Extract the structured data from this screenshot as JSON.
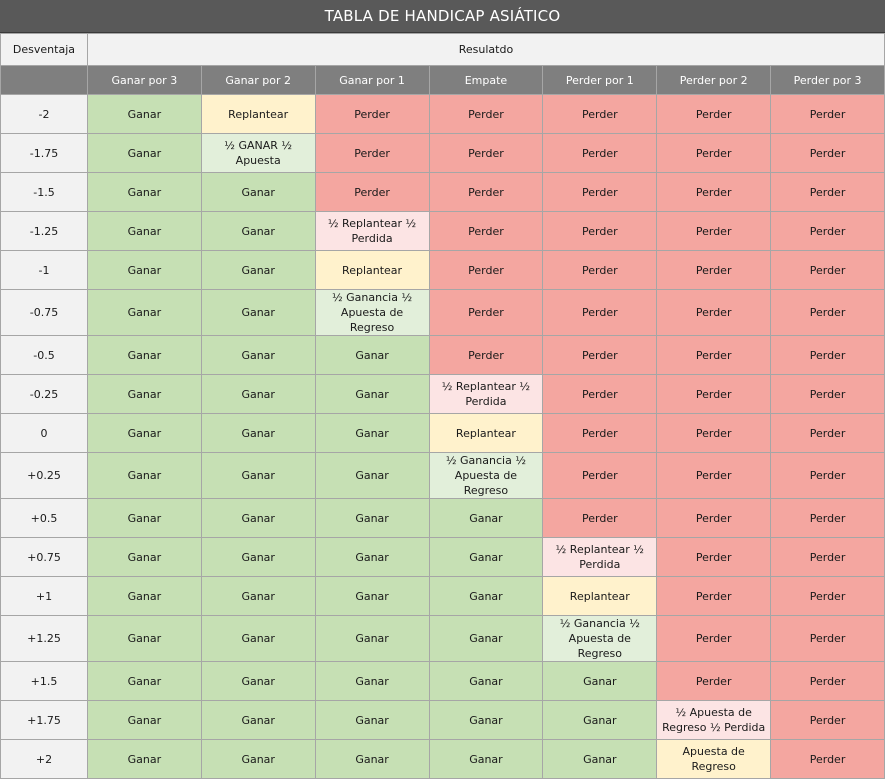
{
  "title": "TABLA DE HANDICAP ASIÁTICO",
  "header": {
    "handicap_label": "Desventaja",
    "result_label": "Resulatdo",
    "columns": [
      "Ganar por 3",
      "Ganar por 2",
      "Ganar por 1",
      "Empate",
      "Perder por 1",
      "Perder por 2",
      "Perder por 3"
    ]
  },
  "colors": {
    "title_bg": "#595959",
    "header_bg": "#7f7f7f",
    "win": "#c6e0b4",
    "lose": "#f4a6a0",
    "push": "#fff2cc",
    "half_lose": "#fce4e4",
    "half_win": "#e2efda"
  },
  "rows": [
    {
      "handicap": "-2",
      "cells": [
        {
          "text": "Ganar",
          "kind": "win"
        },
        {
          "text": "Replantear",
          "kind": "push"
        },
        {
          "text": "Perder",
          "kind": "lose"
        },
        {
          "text": "Perder",
          "kind": "lose"
        },
        {
          "text": "Perder",
          "kind": "lose"
        },
        {
          "text": "Perder",
          "kind": "lose"
        },
        {
          "text": "Perder",
          "kind": "lose"
        }
      ]
    },
    {
      "handicap": "-1.75",
      "cells": [
        {
          "text": "Ganar",
          "kind": "win"
        },
        {
          "text": "½ GANAR ½ Apuesta",
          "kind": "halfwin"
        },
        {
          "text": "Perder",
          "kind": "lose"
        },
        {
          "text": "Perder",
          "kind": "lose"
        },
        {
          "text": "Perder",
          "kind": "lose"
        },
        {
          "text": "Perder",
          "kind": "lose"
        },
        {
          "text": "Perder",
          "kind": "lose"
        }
      ]
    },
    {
      "handicap": "-1.5",
      "cells": [
        {
          "text": "Ganar",
          "kind": "win"
        },
        {
          "text": "Ganar",
          "kind": "win"
        },
        {
          "text": "Perder",
          "kind": "lose"
        },
        {
          "text": "Perder",
          "kind": "lose"
        },
        {
          "text": "Perder",
          "kind": "lose"
        },
        {
          "text": "Perder",
          "kind": "lose"
        },
        {
          "text": "Perder",
          "kind": "lose"
        }
      ]
    },
    {
      "handicap": "-1.25",
      "cells": [
        {
          "text": "Ganar",
          "kind": "win"
        },
        {
          "text": "Ganar",
          "kind": "win"
        },
        {
          "text": "½ Replantear ½ Perdida",
          "kind": "halflose"
        },
        {
          "text": "Perder",
          "kind": "lose"
        },
        {
          "text": "Perder",
          "kind": "lose"
        },
        {
          "text": "Perder",
          "kind": "lose"
        },
        {
          "text": "Perder",
          "kind": "lose"
        }
      ]
    },
    {
      "handicap": "-1",
      "cells": [
        {
          "text": "Ganar",
          "kind": "win"
        },
        {
          "text": "Ganar",
          "kind": "win"
        },
        {
          "text": "Replantear",
          "kind": "push"
        },
        {
          "text": "Perder",
          "kind": "lose"
        },
        {
          "text": "Perder",
          "kind": "lose"
        },
        {
          "text": "Perder",
          "kind": "lose"
        },
        {
          "text": "Perder",
          "kind": "lose"
        }
      ]
    },
    {
      "handicap": "-0.75",
      "cells": [
        {
          "text": "Ganar",
          "kind": "win"
        },
        {
          "text": "Ganar",
          "kind": "win"
        },
        {
          "text": "½ Ganancia ½ Apuesta de Regreso",
          "kind": "halfwin"
        },
        {
          "text": "Perder",
          "kind": "lose"
        },
        {
          "text": "Perder",
          "kind": "lose"
        },
        {
          "text": "Perder",
          "kind": "lose"
        },
        {
          "text": "Perder",
          "kind": "lose"
        }
      ]
    },
    {
      "handicap": "-0.5",
      "cells": [
        {
          "text": "Ganar",
          "kind": "win"
        },
        {
          "text": "Ganar",
          "kind": "win"
        },
        {
          "text": "Ganar",
          "kind": "win"
        },
        {
          "text": "Perder",
          "kind": "lose"
        },
        {
          "text": "Perder",
          "kind": "lose"
        },
        {
          "text": "Perder",
          "kind": "lose"
        },
        {
          "text": "Perder",
          "kind": "lose"
        }
      ]
    },
    {
      "handicap": "-0.25",
      "cells": [
        {
          "text": "Ganar",
          "kind": "win"
        },
        {
          "text": "Ganar",
          "kind": "win"
        },
        {
          "text": "Ganar",
          "kind": "win"
        },
        {
          "text": "½ Replantear ½ Perdida",
          "kind": "halflose"
        },
        {
          "text": "Perder",
          "kind": "lose"
        },
        {
          "text": "Perder",
          "kind": "lose"
        },
        {
          "text": "Perder",
          "kind": "lose"
        }
      ]
    },
    {
      "handicap": "0",
      "cells": [
        {
          "text": "Ganar",
          "kind": "win"
        },
        {
          "text": "Ganar",
          "kind": "win"
        },
        {
          "text": "Ganar",
          "kind": "win"
        },
        {
          "text": "Replantear",
          "kind": "push"
        },
        {
          "text": "Perder",
          "kind": "lose"
        },
        {
          "text": "Perder",
          "kind": "lose"
        },
        {
          "text": "Perder",
          "kind": "lose"
        }
      ]
    },
    {
      "handicap": "+0.25",
      "cells": [
        {
          "text": "Ganar",
          "kind": "win"
        },
        {
          "text": "Ganar",
          "kind": "win"
        },
        {
          "text": "Ganar",
          "kind": "win"
        },
        {
          "text": "½ Ganancia ½ Apuesta de Regreso",
          "kind": "halfwin"
        },
        {
          "text": "Perder",
          "kind": "lose"
        },
        {
          "text": "Perder",
          "kind": "lose"
        },
        {
          "text": "Perder",
          "kind": "lose"
        }
      ]
    },
    {
      "handicap": "+0.5",
      "cells": [
        {
          "text": "Ganar",
          "kind": "win"
        },
        {
          "text": "Ganar",
          "kind": "win"
        },
        {
          "text": "Ganar",
          "kind": "win"
        },
        {
          "text": "Ganar",
          "kind": "win"
        },
        {
          "text": "Perder",
          "kind": "lose"
        },
        {
          "text": "Perder",
          "kind": "lose"
        },
        {
          "text": "Perder",
          "kind": "lose"
        }
      ]
    },
    {
      "handicap": "+0.75",
      "cells": [
        {
          "text": "Ganar",
          "kind": "win"
        },
        {
          "text": "Ganar",
          "kind": "win"
        },
        {
          "text": "Ganar",
          "kind": "win"
        },
        {
          "text": "Ganar",
          "kind": "win"
        },
        {
          "text": "½ Replantear ½ Perdida",
          "kind": "halflose"
        },
        {
          "text": "Perder",
          "kind": "lose"
        },
        {
          "text": "Perder",
          "kind": "lose"
        }
      ]
    },
    {
      "handicap": "+1",
      "cells": [
        {
          "text": "Ganar",
          "kind": "win"
        },
        {
          "text": "Ganar",
          "kind": "win"
        },
        {
          "text": "Ganar",
          "kind": "win"
        },
        {
          "text": "Ganar",
          "kind": "win"
        },
        {
          "text": "Replantear",
          "kind": "push"
        },
        {
          "text": "Perder",
          "kind": "lose"
        },
        {
          "text": "Perder",
          "kind": "lose"
        }
      ]
    },
    {
      "handicap": "+1.25",
      "cells": [
        {
          "text": "Ganar",
          "kind": "win"
        },
        {
          "text": "Ganar",
          "kind": "win"
        },
        {
          "text": "Ganar",
          "kind": "win"
        },
        {
          "text": "Ganar",
          "kind": "win"
        },
        {
          "text": "½ Ganancia ½ Apuesta de Regreso",
          "kind": "halfwin"
        },
        {
          "text": "Perder",
          "kind": "lose"
        },
        {
          "text": "Perder",
          "kind": "lose"
        }
      ]
    },
    {
      "handicap": "+1.5",
      "cells": [
        {
          "text": "Ganar",
          "kind": "win"
        },
        {
          "text": "Ganar",
          "kind": "win"
        },
        {
          "text": "Ganar",
          "kind": "win"
        },
        {
          "text": "Ganar",
          "kind": "win"
        },
        {
          "text": "Ganar",
          "kind": "win"
        },
        {
          "text": "Perder",
          "kind": "lose"
        },
        {
          "text": "Perder",
          "kind": "lose"
        }
      ]
    },
    {
      "handicap": "+1.75",
      "cells": [
        {
          "text": "Ganar",
          "kind": "win"
        },
        {
          "text": "Ganar",
          "kind": "win"
        },
        {
          "text": "Ganar",
          "kind": "win"
        },
        {
          "text": "Ganar",
          "kind": "win"
        },
        {
          "text": "Ganar",
          "kind": "win"
        },
        {
          "text": "½ Apuesta de Regreso ½ Perdida",
          "kind": "halflose"
        },
        {
          "text": "Perder",
          "kind": "lose"
        }
      ]
    },
    {
      "handicap": "+2",
      "cells": [
        {
          "text": "Ganar",
          "kind": "win"
        },
        {
          "text": "Ganar",
          "kind": "win"
        },
        {
          "text": "Ganar",
          "kind": "win"
        },
        {
          "text": "Ganar",
          "kind": "win"
        },
        {
          "text": "Ganar",
          "kind": "win"
        },
        {
          "text": "Apuesta de Regreso",
          "kind": "push"
        },
        {
          "text": "Perder",
          "kind": "lose"
        }
      ]
    }
  ]
}
